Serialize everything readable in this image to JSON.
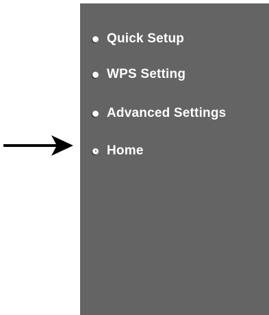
{
  "menu": {
    "items": [
      {
        "label": "Quick Setup",
        "icon": "bullet-icon",
        "active": false
      },
      {
        "label": "WPS Setting",
        "icon": "bullet-icon",
        "active": false
      },
      {
        "label": "Advanced Settings",
        "icon": "bullet-icon",
        "active": false
      },
      {
        "label": "Home",
        "icon": "bullet-icon",
        "active": true
      }
    ]
  },
  "colors": {
    "sidebar_background": "#646464",
    "text": "#ffffff",
    "arrow": "#000000"
  },
  "pointer": {
    "icon": "arrow-right-icon",
    "target": "Home"
  }
}
